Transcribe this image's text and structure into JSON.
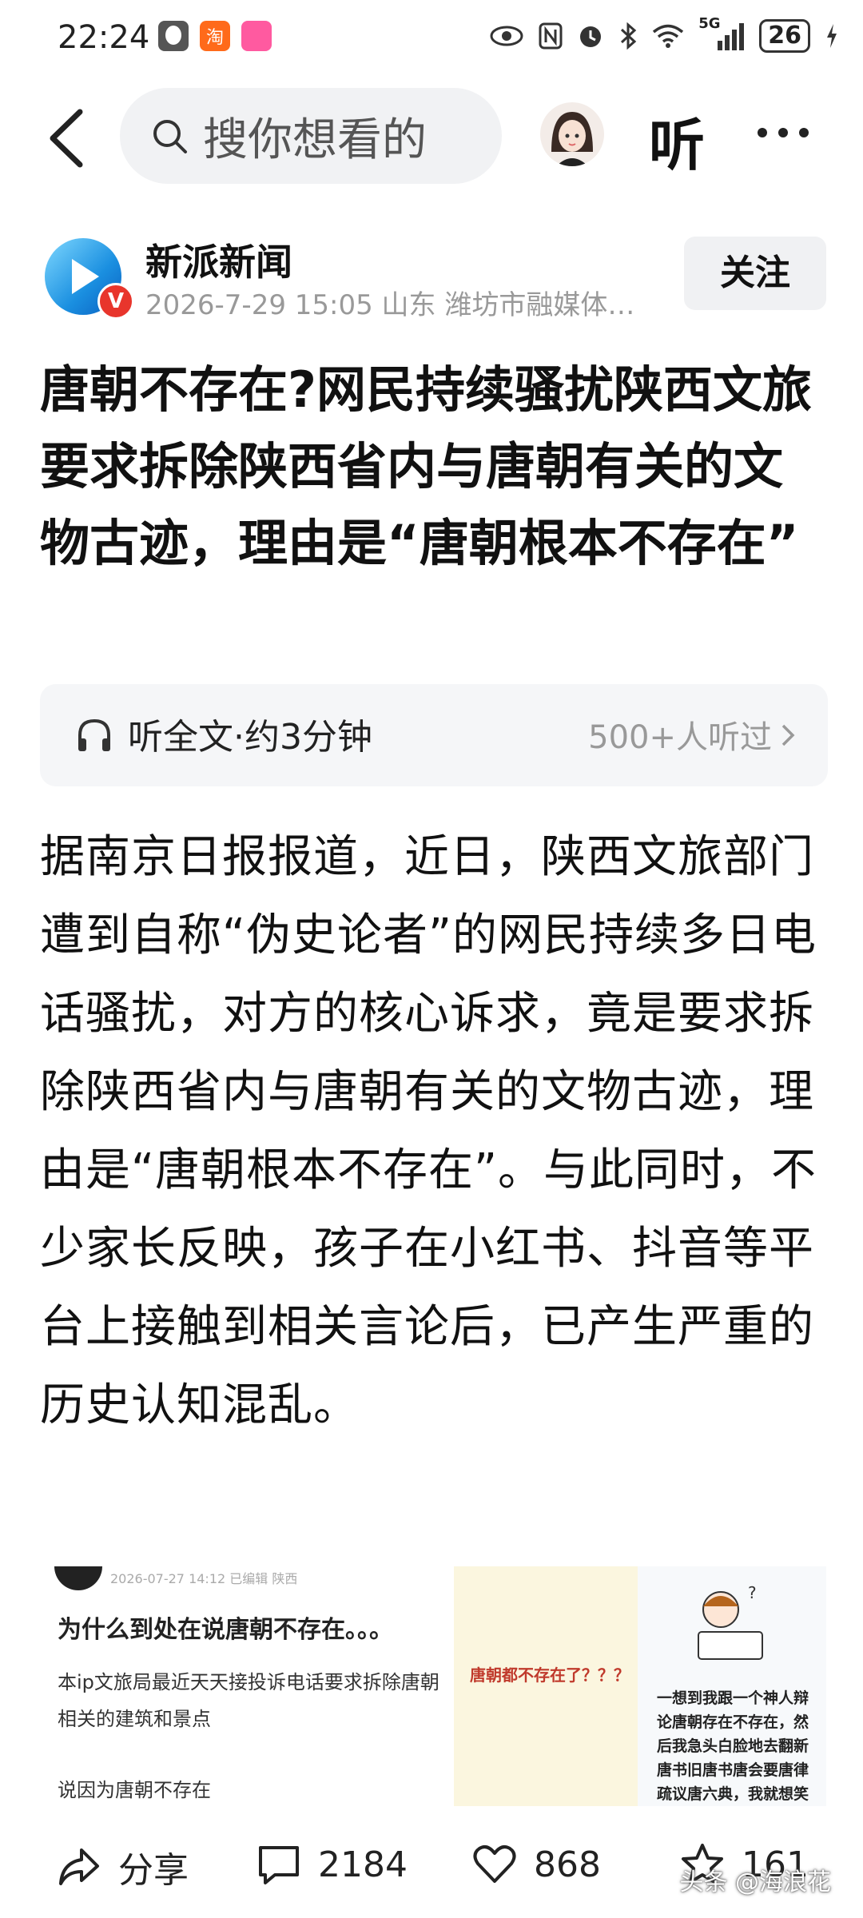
{
  "status_bar": {
    "time": "22:24",
    "app_icon_1": "淘",
    "app_icon_2_colors": "#ff5aa0",
    "network": "5G",
    "battery": "26"
  },
  "nav": {
    "search_placeholder": "搜你想看的",
    "listen_label": "听"
  },
  "author": {
    "name": "新派新闻",
    "badge": "V",
    "meta": "2026-7-29  15:05  山东  潍坊市融媒体…",
    "follow_label": "关注"
  },
  "article": {
    "title": "唐朝不存在?网民持续骚扰陕西文旅要求拆除陕西省内与唐朝有关的文物古迹，理由是“唐朝根本不存在”",
    "listen_full": "听全文·约3分钟",
    "listen_count": "500+人听过",
    "body": "据南京日报报道，近日，陕西文旅部门遭到自称“伪史论者”的网民持续多日电话骚扰，对方的核心诉求，竟是要求拆除陕西省内与唐朝有关的文物古迹，理由是“唐朝根本不存在”。与此同时，不少家长反映，孩子在小红书、抖音等平台上接触到相关言论后，已产生严重的历史认知混乱。"
  },
  "image": {
    "left_header": "2026-07-27 14:12  已编辑  陕西",
    "left_title": "为什么到处在说唐朝不存在。。。",
    "left_p1": "本ip文旅局最近天天接投诉电话要求拆除唐朝相关的建筑和景点",
    "left_p2": "说因为唐朝不存在",
    "mid_text": "唐朝都不存在了？？？",
    "right_text": "一想到我跟一个神人辩论唐朝存在不存在，然后我急头白脸地去翻新唐书旧唐书唐会要唐律疏议唐六典，我就想笑"
  },
  "bottom": {
    "share": "分享",
    "comments": "2184",
    "likes": "868",
    "favorites": "161",
    "watermark": "头条 @海浪花"
  },
  "icons": {
    "back": "back-arrow-icon",
    "search": "search-icon",
    "more": "more-dots-icon",
    "headphones": "headphones-icon",
    "chevron": "chevron-right-icon",
    "share": "share-icon",
    "comment": "comment-icon",
    "like": "heart-icon",
    "favorite": "star-icon"
  }
}
